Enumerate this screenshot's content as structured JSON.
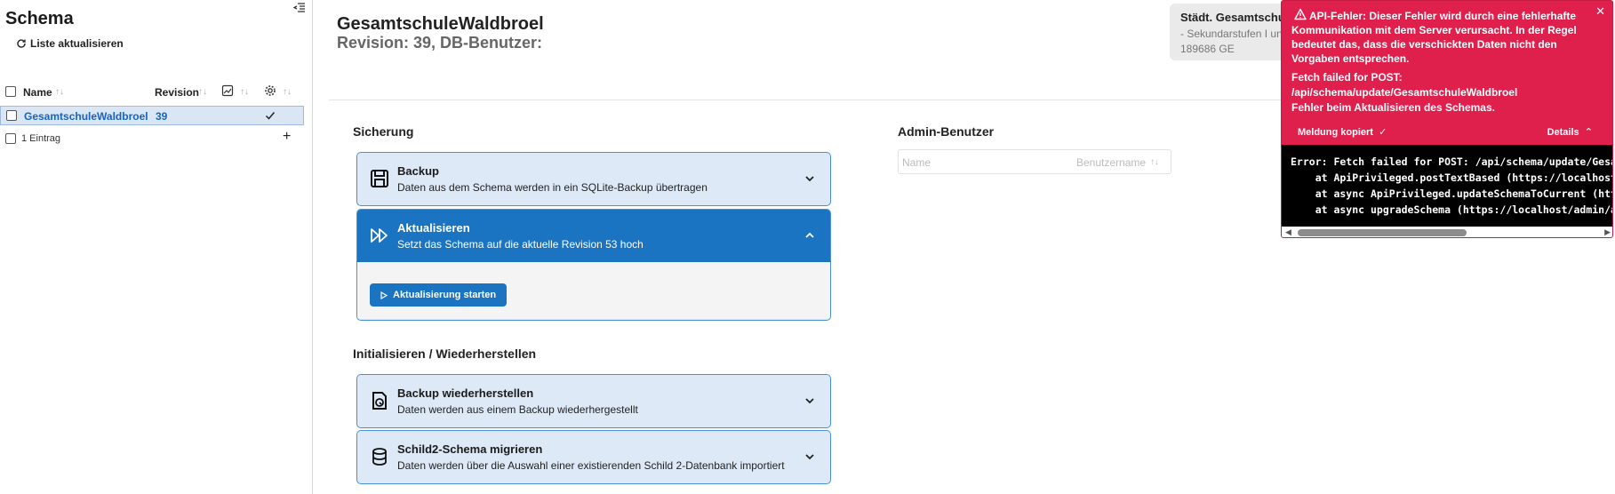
{
  "sidebar": {
    "title": "Schema",
    "refresh_label": "Liste aktualisieren",
    "columns": {
      "name": "Name",
      "revision": "Revision"
    },
    "rows": [
      {
        "name": "GesamtschuleWaldbroel",
        "revision": "39"
      }
    ],
    "footer_count": "1 Eintrag"
  },
  "main": {
    "title": "GesamtschuleWaldbroel",
    "subtitle": "Revision: 39, DB-Benutzer:",
    "school_card": {
      "name": "Städt. Gesamtschule",
      "type": "- Sekundarstufen I und",
      "number": "189686 GE"
    },
    "backup_section": {
      "title": "Sicherung",
      "items": [
        {
          "title": "Backup",
          "subtitle": "Daten aus dem Schema werden in ein SQLite-Backup übertragen"
        },
        {
          "title": "Aktualisieren",
          "subtitle": "Setzt das Schema auf die aktuelle Revision 53 hoch",
          "button": "Aktualisierung starten"
        }
      ]
    },
    "init_section": {
      "title": "Initialisieren / Wiederherstellen",
      "items": [
        {
          "title": "Backup wiederherstellen",
          "subtitle": "Daten werden aus einem Backup wiederhergestellt"
        },
        {
          "title": "Schild2-Schema migrieren",
          "subtitle": "Daten werden über die Auswahl einer existierenden Schild 2-Datenbank importiert"
        }
      ]
    },
    "admin": {
      "title": "Admin-Benutzer",
      "col_name": "Name",
      "col_username": "Benutzername"
    }
  },
  "error": {
    "message": "API-Fehler: Dieser Fehler wird durch eine fehlerhafte Kommunikation mit dem Server verursacht. In der Regel bedeutet das, dass die verschickten Daten nicht den Vorgaben entsprechen.",
    "fetch_line1": "Fetch failed for POST:",
    "fetch_line2": "/api/schema/update/GesamtschuleWaldbroel",
    "fetch_line3": "Fehler beim Aktualisieren des Schemas.",
    "copied_label": "Meldung kopiert",
    "details_label": "Details",
    "code": "Error: Fetch failed for POST: /api/schema/update/GesamtschuleWaldbroel\n    at ApiPrivileged.postTextBased (https://localhost/admin/assets\n    at async ApiPrivileged.updateSchemaToCurrent (https://localhost\n    at async upgradeSchema (https://localhost/admin/assets/index"
  },
  "colors": {
    "accent": "#1a74c2",
    "error": "#e0204c",
    "panel": "#dde9f6"
  }
}
